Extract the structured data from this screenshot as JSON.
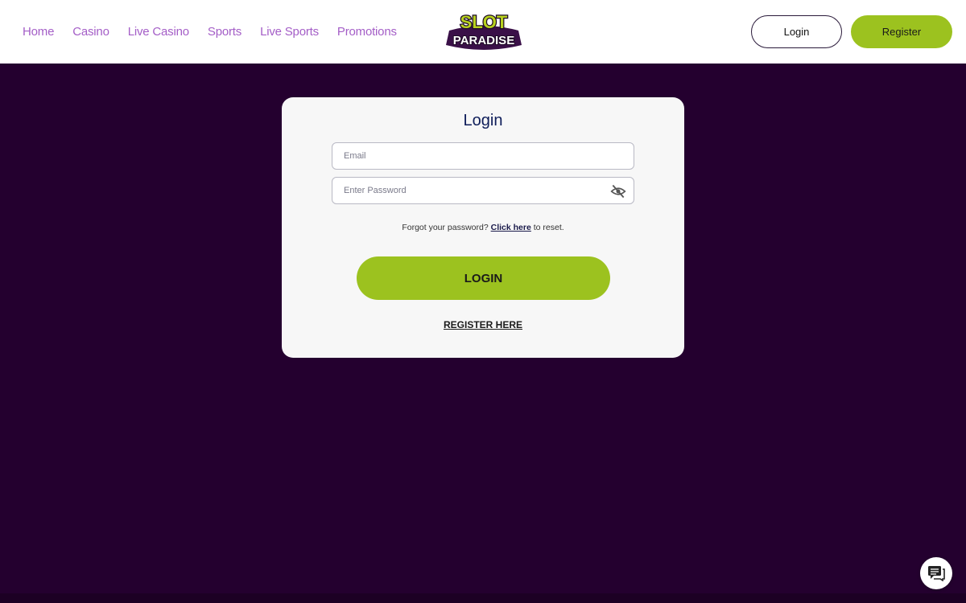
{
  "header": {
    "nav": [
      "Home",
      "Casino",
      "Live Casino",
      "Sports",
      "Live Sports",
      "Promotions"
    ],
    "logo": {
      "line1": "SLOT",
      "line2": "PARADISE"
    },
    "login_label": "Login",
    "register_label": "Register"
  },
  "login_form": {
    "title": "Login",
    "email_placeholder": "Email",
    "password_placeholder": "Enter Password",
    "forgot_prefix": "Forgot your password?",
    "forgot_link": "Click here",
    "forgot_suffix": "to reset.",
    "submit_label": "LOGIN",
    "register_link": "REGISTER HERE"
  },
  "icons": {
    "password_toggle": "eye-off-icon",
    "chat": "chat-icon"
  },
  "colors": {
    "background": "#24002f",
    "accent": "#9cc21f",
    "nav_text": "#a45ec7",
    "title": "#0f1e5a"
  }
}
